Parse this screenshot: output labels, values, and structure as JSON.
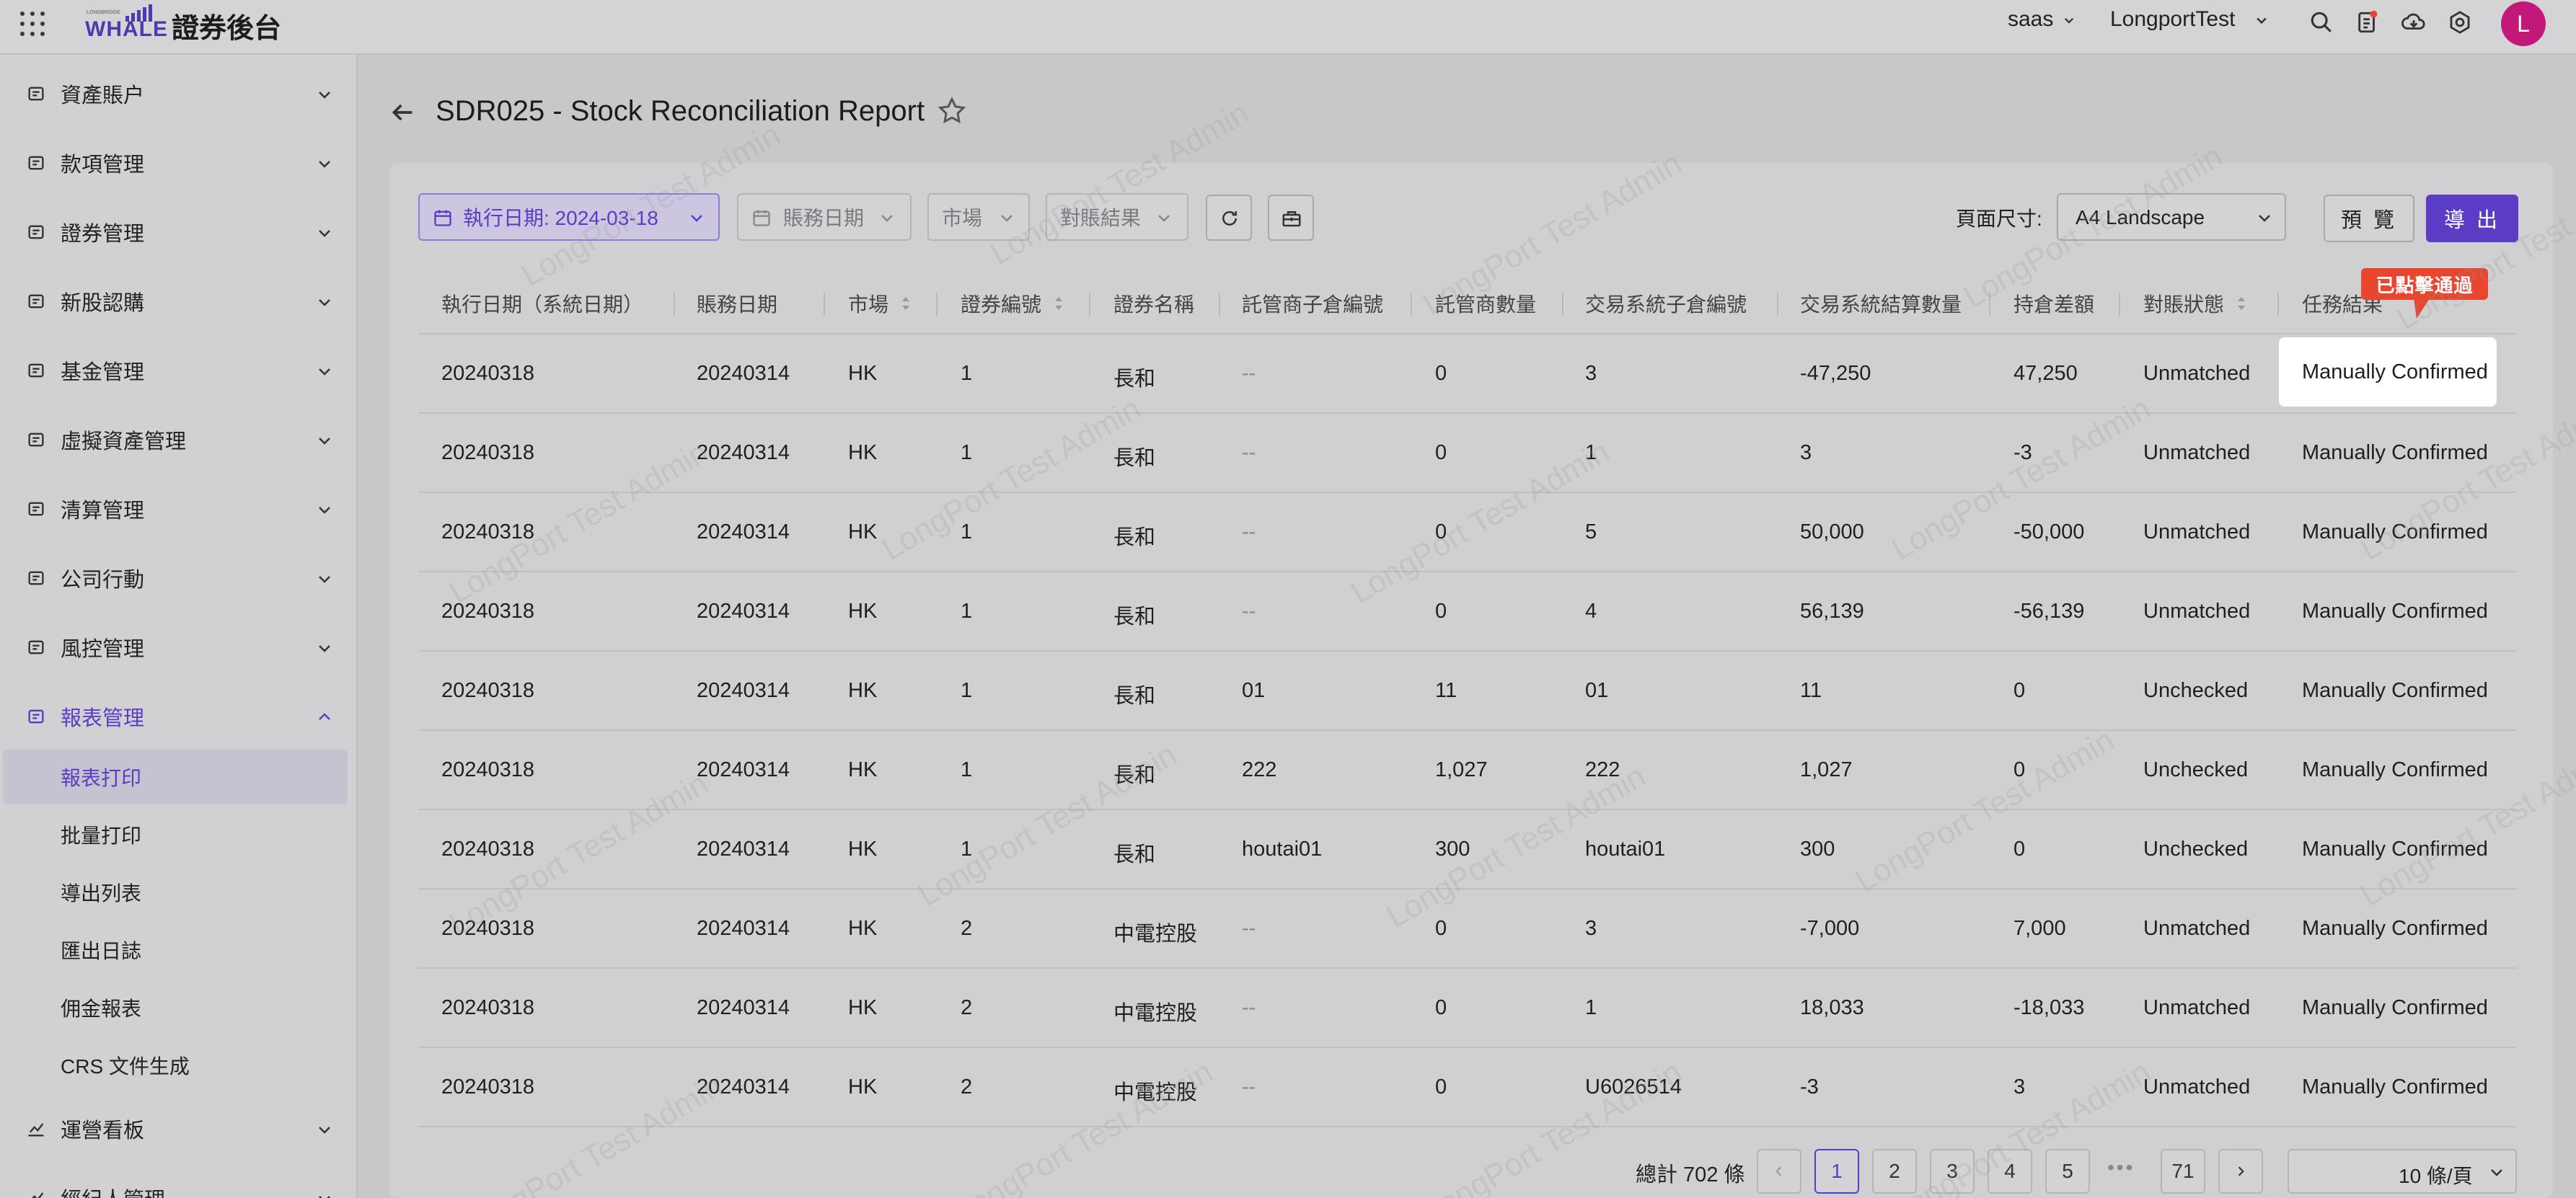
{
  "header": {
    "brand_title": "證券後台",
    "logo_text": "WHALE",
    "logo_small": "LONGBRIDGE",
    "tenant": "saas",
    "user": "LongportTest",
    "avatar_initial": "L",
    "icons": [
      "apps-icon",
      "search-icon",
      "notification-doc-icon",
      "cloud-download-icon",
      "settings-icon"
    ]
  },
  "sidebar": {
    "items": [
      {
        "label": "資產賬户",
        "icon": "wallet-icon"
      },
      {
        "label": "款項管理",
        "icon": "payment-icon"
      },
      {
        "label": "證券管理",
        "icon": "securities-icon"
      },
      {
        "label": "新股認購",
        "icon": "ipo-icon"
      },
      {
        "label": "基金管理",
        "icon": "fund-chart-icon"
      },
      {
        "label": "虛擬資產管理",
        "icon": "virtual-asset-icon"
      },
      {
        "label": "清算管理",
        "icon": "clearing-icon"
      },
      {
        "label": "公司行動",
        "icon": "corporate-action-icon"
      },
      {
        "label": "風控管理",
        "icon": "risk-control-icon"
      },
      {
        "label": "報表管理",
        "icon": "report-icon"
      }
    ],
    "sub_items": [
      "報表打印",
      "批量打印",
      "導出列表",
      "匯出日誌",
      "佣金報表",
      "CRS 文件生成"
    ],
    "after_items": [
      {
        "label": "運營看板",
        "icon": "dashboard-chart-icon"
      },
      {
        "label": "經紀人管理",
        "icon": "broker-icon"
      }
    ],
    "accent": "#5b3cc4"
  },
  "page": {
    "title": "SDR025 - Stock Reconciliation Report"
  },
  "filters": {
    "exec_date": "執行日期: 2024-03-18",
    "account_date": "賬務日期",
    "market": "市場",
    "result": "對賬結果",
    "page_size_label": "頁面尺寸:",
    "page_size_value": "A4 Landscape",
    "preview": "預 覽",
    "export": "導 出"
  },
  "table": {
    "headers": [
      "執行日期（系統日期）",
      "賬務日期",
      "市場",
      "證券編號",
      "證券名稱",
      "託管商子倉編號",
      "託管商數量",
      "交易系統子倉編號",
      "交易系統結算數量",
      "持倉差額",
      "對賬狀態",
      "任務結果"
    ],
    "rows": [
      [
        "20240318",
        "20240314",
        "HK",
        "1",
        "長和",
        "--",
        "0",
        "3",
        "-47,250",
        "47,250",
        "Unmatched",
        "Manually Confirmed"
      ],
      [
        "20240318",
        "20240314",
        "HK",
        "1",
        "長和",
        "--",
        "0",
        "1",
        "3",
        "-3",
        "Unmatched",
        "Manually Confirmed"
      ],
      [
        "20240318",
        "20240314",
        "HK",
        "1",
        "長和",
        "--",
        "0",
        "5",
        "50,000",
        "-50,000",
        "Unmatched",
        "Manually Confirmed"
      ],
      [
        "20240318",
        "20240314",
        "HK",
        "1",
        "長和",
        "--",
        "0",
        "4",
        "56,139",
        "-56,139",
        "Unmatched",
        "Manually Confirmed"
      ],
      [
        "20240318",
        "20240314",
        "HK",
        "1",
        "長和",
        "01",
        "11",
        "01",
        "11",
        "0",
        "Unchecked",
        "Manually Confirmed"
      ],
      [
        "20240318",
        "20240314",
        "HK",
        "1",
        "長和",
        "222",
        "1,027",
        "222",
        "1,027",
        "0",
        "Unchecked",
        "Manually Confirmed"
      ],
      [
        "20240318",
        "20240314",
        "HK",
        "1",
        "長和",
        "houtai01",
        "300",
        "houtai01",
        "300",
        "0",
        "Unchecked",
        "Manually Confirmed"
      ],
      [
        "20240318",
        "20240314",
        "HK",
        "2",
        "中電控股",
        "--",
        "0",
        "3",
        "-7,000",
        "7,000",
        "Unmatched",
        "Manually Confirmed"
      ],
      [
        "20240318",
        "20240314",
        "HK",
        "2",
        "中電控股",
        "--",
        "0",
        "1",
        "18,033",
        "-18,033",
        "Unmatched",
        "Manually Confirmed"
      ],
      [
        "20240318",
        "20240314",
        "HK",
        "2",
        "中電控股",
        "--",
        "0",
        "U6026514",
        "-3",
        "3",
        "Unmatched",
        "Manually Confirmed"
      ]
    ],
    "highlight_tooltip": "已點擊通過"
  },
  "pagination": {
    "total": "總計 702 條",
    "pages": [
      "1",
      "2",
      "3",
      "4",
      "5"
    ],
    "last_page": "71",
    "ellipsis": "•••",
    "current": "1",
    "per_page": "10 條/頁"
  },
  "watermark": "LongPort Test Admin"
}
